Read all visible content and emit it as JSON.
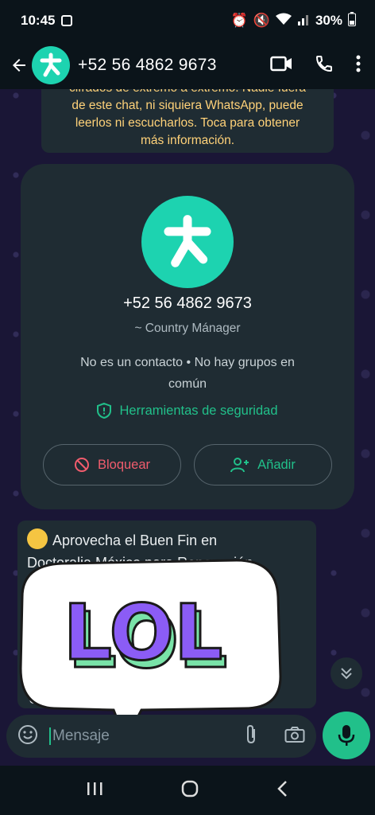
{
  "status_bar": {
    "time": "10:45",
    "battery": "30%"
  },
  "header": {
    "title": "+52 56 4862 9673"
  },
  "notice": {
    "lines": [
      "cifrados de extremo a extremo. Nadie fuera",
      "de este chat, ni siquiera WhatsApp, puede",
      "leerlos ni escucharlos. Toca para obtener",
      "más información."
    ]
  },
  "profile_card": {
    "phone": "+52 56 4862 9673",
    "role": "~ Country Mánager",
    "info_line1": "No es un contacto • No hay grupos en",
    "info_line2": "común",
    "security_label": "Herramientas de seguridad",
    "block_label": "Bloquear",
    "add_label": "Añadir"
  },
  "message": {
    "line1": "Aprovecha el Buen Fin en",
    "line2": "Doctoralia México para Renovación",
    "tail": "Un"
  },
  "sticker": {
    "text": "LOL"
  },
  "input": {
    "placeholder": "Mensaje"
  },
  "colors": {
    "accent": "#21c08a",
    "avatar": "#1dd3b0",
    "danger": "#f15c6d",
    "notice": "#ffd279"
  }
}
